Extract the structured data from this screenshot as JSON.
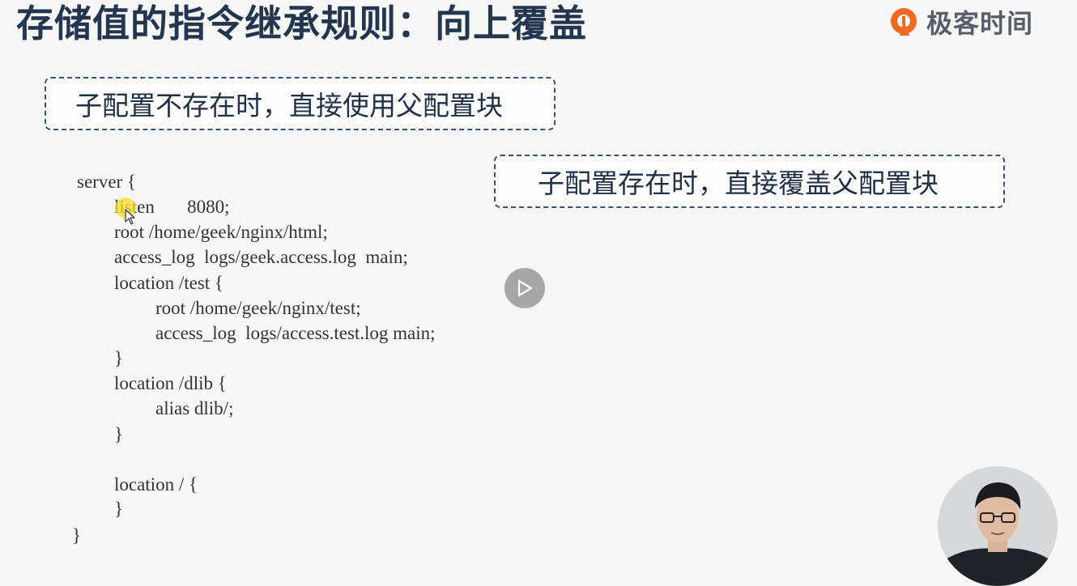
{
  "slide": {
    "title": "存储值的指令继承规则：向上覆盖"
  },
  "brand": {
    "name": "极客时间",
    "icon": "geektime-logo-icon",
    "accent_color": "#f0691f"
  },
  "callouts": {
    "first": "子配置不存在时，直接使用父配置块",
    "second": "子配置存在时，直接覆盖父配置块"
  },
  "code": {
    "lines": [
      "server {",
      "listen       8080;",
      "root /home/geek/nginx/html;",
      "access_log  logs/geek.access.log  main;",
      "location /test {",
      "root /home/geek/nginx/test;",
      "access_log  logs/access.test.log main;",
      "}",
      "location /dlib {",
      "alias dlib/;",
      "}",
      "location / {",
      "}",
      "}"
    ]
  },
  "player": {
    "play_icon": "play-icon",
    "presenter": "presenter-video"
  },
  "colors": {
    "title": "#24364f",
    "callout_border": "#3c4f6b",
    "code_text": "#333333",
    "background": "#f7f7f7",
    "highlight": "#ffde28"
  }
}
